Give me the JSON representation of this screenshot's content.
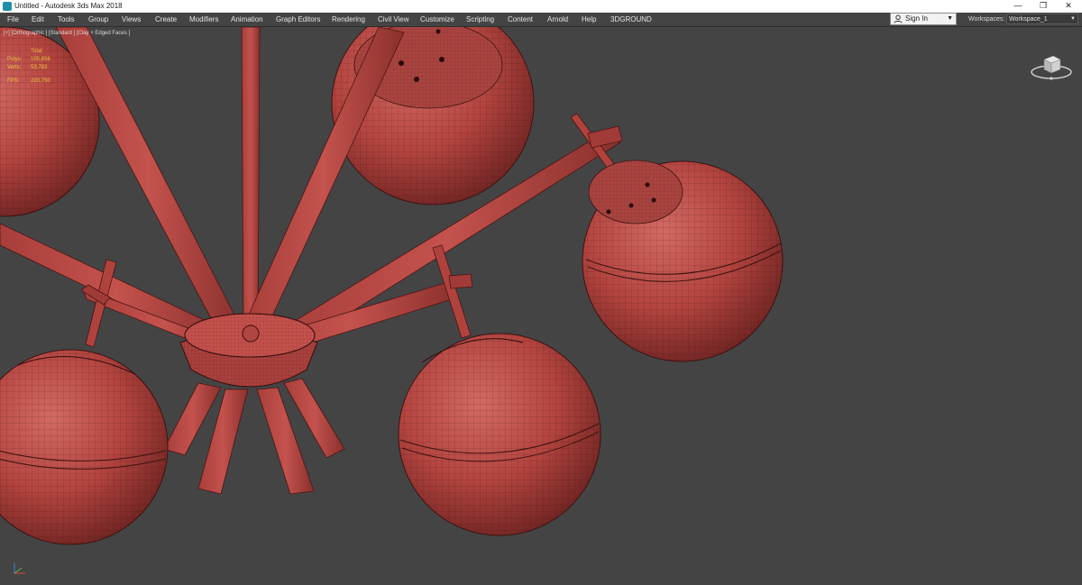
{
  "window": {
    "title": "Untitled - Autodesk 3ds Max 2018",
    "minimize_glyph": "—",
    "restore_glyph": "❐",
    "close_glyph": "✕"
  },
  "menu": [
    {
      "label": "File"
    },
    {
      "label": "Edit"
    },
    {
      "label": "Tools"
    },
    {
      "label": "Group"
    },
    {
      "label": "Views"
    },
    {
      "label": "Create"
    },
    {
      "label": "Modifiers"
    },
    {
      "label": "Animation"
    },
    {
      "label": "Graph Editors"
    },
    {
      "label": "Rendering"
    },
    {
      "label": "Civil View"
    },
    {
      "label": "Customize"
    },
    {
      "label": "Scripting"
    },
    {
      "label": "Content"
    },
    {
      "label": "Arnold"
    },
    {
      "label": "Help"
    },
    {
      "label": "3DGROUND"
    }
  ],
  "account": {
    "sign_in_label": "Sign In",
    "caret": "▼"
  },
  "workspace": {
    "label": "Workspaces:",
    "value": "Workspace_1",
    "caret": "▼"
  },
  "viewport": {
    "label": "[+] [Orthographic ] [Standard ] [Clay + Edged Faces ]",
    "stats": {
      "header": "Total",
      "rows": [
        {
          "key": "Polys:",
          "value": "105,856"
        },
        {
          "key": "Verts:",
          "value": "53,783"
        },
        {
          "key": "FPS:",
          "value": "220,750"
        }
      ]
    },
    "model_color": "#c0504d",
    "background_color": "#444444"
  },
  "icons": {
    "app": "3ds-max-icon",
    "account": "user-icon",
    "viewcube": "viewcube-icon",
    "axis": "axis-tripod-icon"
  }
}
